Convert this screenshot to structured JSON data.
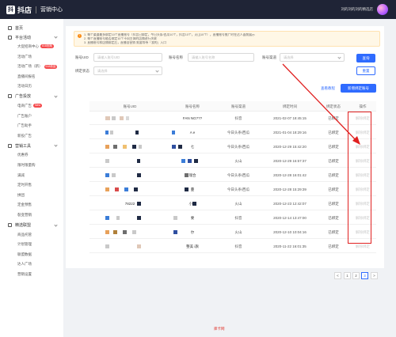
{
  "app": {
    "logo_char": "抖",
    "logo_text": "抖店",
    "subtitle": "营销中心",
    "user_name": "刘的刘的刘的精选店"
  },
  "sidebar": {
    "home": "首页",
    "groups": [
      {
        "title": "平台活动",
        "items": [
          {
            "label": "大促招商中心",
            "badge": "618抢跑"
          },
          {
            "label": "活动广场",
            "badge": ""
          },
          {
            "label": "活动广场（新）",
            "badge": "618新品"
          },
          {
            "label": "直播间报名",
            "badge": ""
          },
          {
            "label": "活动日历",
            "badge": ""
          }
        ]
      },
      {
        "title": "广告投放",
        "items": [
          {
            "label": "电商广告",
            "badge": "New"
          },
          {
            "label": "广告账户",
            "badge": ""
          },
          {
            "label": "广告助手",
            "badge": ""
          },
          {
            "label": "新投广告",
            "badge": ""
          }
        ]
      },
      {
        "title": "营销工具",
        "items": [
          {
            "label": "优惠券",
            "badge": ""
          },
          {
            "label": "限时限量购",
            "badge": ""
          },
          {
            "label": "满减",
            "badge": ""
          },
          {
            "label": "定时开售",
            "badge": ""
          },
          {
            "label": "拼团",
            "badge": ""
          },
          {
            "label": "定金预售",
            "badge": ""
          },
          {
            "label": "裂变营销",
            "badge": ""
          }
        ]
      },
      {
        "title": "精选联盟",
        "items": [
          {
            "label": "商品托管",
            "badge": ""
          },
          {
            "label": "计划管理",
            "badge": ""
          },
          {
            "label": "联盟数据",
            "badge": ""
          },
          {
            "label": "达人广场",
            "badge": ""
          },
          {
            "label": "营销设置",
            "badge": ""
          }
        ]
      }
    ]
  },
  "notice": {
    "lines": [
      "1. 每个渠道最多绑定10个直播账号（抖音已绑定，今日头条/西瓜10个，抖音10个，火山10个），直播账号推广时在达人面前展示",
      "2. 每个直播账号能否绑定10个不同主体的店铺进行关联",
      "3. 直播账号和店铺绑定后，直播自营销 需要等待「我的」入口"
    ]
  },
  "filters": {
    "account_uid_label": "账号UID",
    "account_uid_placeholder": "请输入账号UID",
    "account_name_label": "账号名称",
    "account_name_placeholder": "请输入账号名称",
    "channel_label": "账号渠道",
    "channel_placeholder": "请选择",
    "status_label": "绑定状态",
    "status_placeholder": "请选择",
    "query_button": "查询",
    "reset_button": "重置"
  },
  "actions": {
    "view_tutorial": "查看教程",
    "add_account": "新增绑定账号"
  },
  "table": {
    "columns": [
      "账号UID",
      "账号名称",
      "账号渠道",
      "绑定时间",
      "绑定状态",
      "操作"
    ],
    "rows": [
      {
        "uid": "",
        "name": "FAN   NG???",
        "channel": "抖音",
        "time": "2021-02-07 18:45:15",
        "status": "已绑定",
        "op": "解除绑定"
      },
      {
        "uid": "",
        "name": "A     e",
        "channel": "今日头条/西瓜",
        "time": "2021-01-04 18:29:16",
        "status": "已绑定",
        "op": "解除绑定"
      },
      {
        "uid": "",
        "name": "七",
        "channel": "今日头条/西瓜",
        "time": "2020-12-29 15:42:20",
        "status": "已绑定",
        "op": "解除绑定"
      },
      {
        "uid": "",
        "name": "",
        "channel": "火山",
        "time": "2020-12-29 16:57:37",
        "status": "已绑定",
        "op": "解除绑定"
      },
      {
        "uid": "",
        "name": "瑞合",
        "channel": "今日头条/西瓜",
        "time": "2020-12-28 16:01:42",
        "status": "已绑定",
        "op": "解除绑定"
      },
      {
        "uid": "",
        "name": "蔓",
        "channel": "今日头条/西瓜",
        "time": "2020-12-28 15:29:39",
        "status": "已绑定",
        "op": "解除绑定"
      },
      {
        "uid": "78222",
        "name": "小青",
        "channel": "火山",
        "time": "2020-12-23 12:42:07",
        "status": "已绑定",
        "op": "解除绑定"
      },
      {
        "uid": "",
        "name": "要",
        "channel": "抖音",
        "time": "2020-12-14 13:47:00",
        "status": "已绑定",
        "op": "解除绑定"
      },
      {
        "uid": "",
        "name": "尔",
        "channel": "火山",
        "time": "2020-12-10 10:04:16",
        "status": "已绑定",
        "op": "解除绑定"
      },
      {
        "uid": "",
        "name": "整美     i旗",
        "channel": "抖音",
        "time": "2020-11-22 16:01:35",
        "status": "已绑定",
        "op": "解除绑定"
      }
    ]
  },
  "pagination": {
    "prev": "<",
    "pages": [
      "1",
      "2",
      "3"
    ],
    "current": "3",
    "next": ">"
  },
  "footer": {
    "watermark": "库卡网"
  },
  "colors": {
    "primary": "#2f6bff",
    "highlight": "#e02020",
    "topbar": "#1f2436"
  }
}
